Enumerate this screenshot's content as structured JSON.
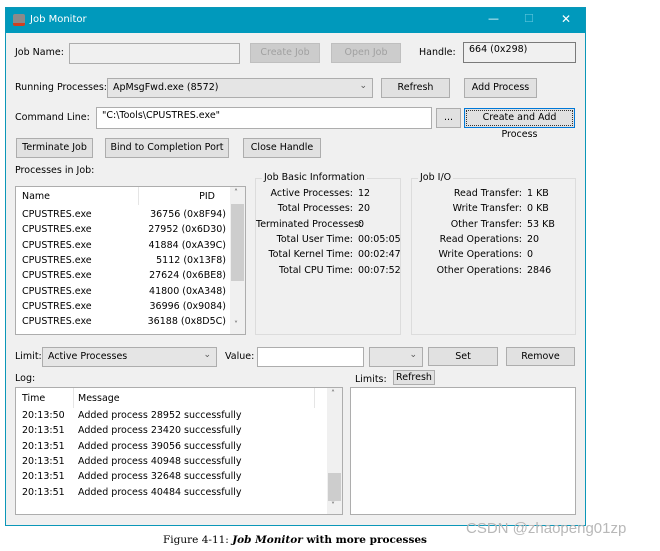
{
  "window": {
    "title": "Job Monitor",
    "minimize": "—",
    "maximize": "☐",
    "close": "✕"
  },
  "job_name": {
    "label": "Job Name:",
    "value": "",
    "create": "Create Job",
    "open": "Open Job",
    "handle_label": "Handle:",
    "handle_value": "664 (0x298)"
  },
  "running": {
    "label": "Running Processes:",
    "selected": "ApMsgFwd.exe (8572)",
    "refresh": "Refresh",
    "add": "Add Process"
  },
  "command": {
    "label": "Command Line:",
    "value": "\"C:\\Tools\\CPUSTRES.exe\"",
    "browse": "...",
    "create_add": "Create and Add Process"
  },
  "actions": {
    "terminate": "Terminate Job",
    "bind": "Bind to Completion Port",
    "close_handle": "Close Handle"
  },
  "processes": {
    "label": "Processes in Job:",
    "columns": [
      "Name",
      "PID"
    ],
    "rows": [
      [
        "CPUSTRES.exe",
        "36756 (0x8F94)"
      ],
      [
        "CPUSTRES.exe",
        "27952 (0x6D30)"
      ],
      [
        "CPUSTRES.exe",
        "41884 (0xA39C)"
      ],
      [
        "CPUSTRES.exe",
        "5112 (0x13F8)"
      ],
      [
        "CPUSTRES.exe",
        "27624 (0x6BE8)"
      ],
      [
        "CPUSTRES.exe",
        "41800 (0xA348)"
      ],
      [
        "CPUSTRES.exe",
        "36996 (0x9084)"
      ],
      [
        "CPUSTRES.exe",
        "36188 (0x8D5C)"
      ]
    ]
  },
  "basic": {
    "title": "Job Basic Information",
    "items": [
      {
        "k": "Active Processes:",
        "v": "12"
      },
      {
        "k": "Total Processes:",
        "v": "20"
      },
      {
        "k": "Terminated Processes:",
        "v": "0"
      },
      {
        "k": "Total User Time:",
        "v": "00:05:05"
      },
      {
        "k": "Total Kernel Time:",
        "v": "00:02:47"
      },
      {
        "k": "Total CPU Time:",
        "v": "00:07:52"
      }
    ]
  },
  "io": {
    "title": "Job I/O",
    "items": [
      {
        "k": "Read Transfer:",
        "v": "1 KB"
      },
      {
        "k": "Write Transfer:",
        "v": "0 KB"
      },
      {
        "k": "Other Transfer:",
        "v": "53 KB"
      },
      {
        "k": "Read Operations:",
        "v": "20"
      },
      {
        "k": "Write Operations:",
        "v": "0"
      },
      {
        "k": "Other Operations:",
        "v": "2846"
      }
    ]
  },
  "limit": {
    "label": "Limit:",
    "selected": "Active Processes",
    "value_label": "Value:",
    "value": "",
    "unit": "",
    "set": "Set",
    "remove": "Remove"
  },
  "log": {
    "label": "Log:",
    "columns": [
      "Time",
      "Message"
    ],
    "rows": [
      [
        "20:13:50",
        "Added process 28952 successfully"
      ],
      [
        "20:13:51",
        "Added process 23420 successfully"
      ],
      [
        "20:13:51",
        "Added process 39056 successfully"
      ],
      [
        "20:13:51",
        "Added process 40948 successfully"
      ],
      [
        "20:13:51",
        "Added process 32648 successfully"
      ],
      [
        "20:13:51",
        "Added process 40484 successfully"
      ]
    ]
  },
  "limits": {
    "label": "Limits:",
    "refresh": "Refresh"
  },
  "caption": {
    "prefix": "Figure 4-11: ",
    "italic": "Job Monitor",
    "suffix": " with more processes"
  },
  "watermark": "CSDN @zhaopeng01zp",
  "colors": {
    "titlebar": "#0099bc",
    "focus": "#0078d7"
  }
}
